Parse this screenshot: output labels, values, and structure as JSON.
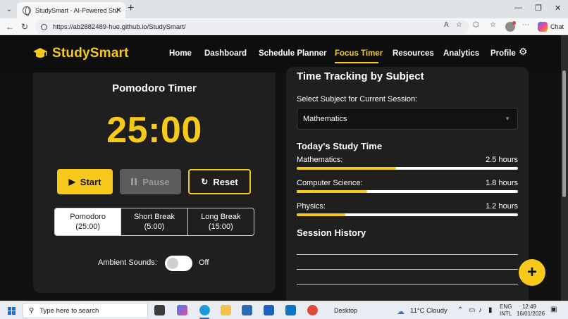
{
  "browser": {
    "tab_title": "StudySmart - AI-Powered Study Pl",
    "url": "https://ab2882489-hue.github.io/StudySmart/",
    "chat_label": "Chat"
  },
  "nav": {
    "logo": "StudySmart",
    "links": [
      "Home",
      "Dashboard",
      "Schedule Planner",
      "Focus Timer",
      "Resources",
      "Analytics",
      "Profile"
    ],
    "active": "Focus Timer"
  },
  "timer": {
    "title": "Pomodoro Timer",
    "display": "25:00",
    "start_label": "Start",
    "pause_label": "Pause",
    "reset_label": "Reset",
    "modes": [
      {
        "name": "Pomodoro",
        "duration": "(25:00)",
        "active": true
      },
      {
        "name": "Short Break",
        "duration": "(5:00)",
        "active": false
      },
      {
        "name": "Long Break",
        "duration": "(15:00)",
        "active": false
      }
    ],
    "ambient_label": "Ambient Sounds:",
    "ambient_state": "Off"
  },
  "tracking": {
    "title": "Time Tracking by Subject",
    "select_label": "Select Subject for Current Session:",
    "select_value": "Mathematics",
    "today_title": "Today's Study Time",
    "subjects": [
      {
        "name": "Mathematics:",
        "hours": "2.5 hours",
        "progress": 0.45
      },
      {
        "name": "Computer Science:",
        "hours": "1.8 hours",
        "progress": 0.32
      },
      {
        "name": "Physics:",
        "hours": "1.2 hours",
        "progress": 0.22
      }
    ],
    "history_title": "Session History"
  },
  "taskbar": {
    "search_placeholder": "Type here to search",
    "desktop_label": "Desktop",
    "weather": "11°C  Cloudy",
    "lang_line1": "ENG",
    "lang_line2": "INTL",
    "time": "12:49",
    "date": "16/01/2026"
  },
  "colors": {
    "accent": "#f7c91b",
    "page_bg": "#111111",
    "card_bg": "#1f1f1f"
  }
}
